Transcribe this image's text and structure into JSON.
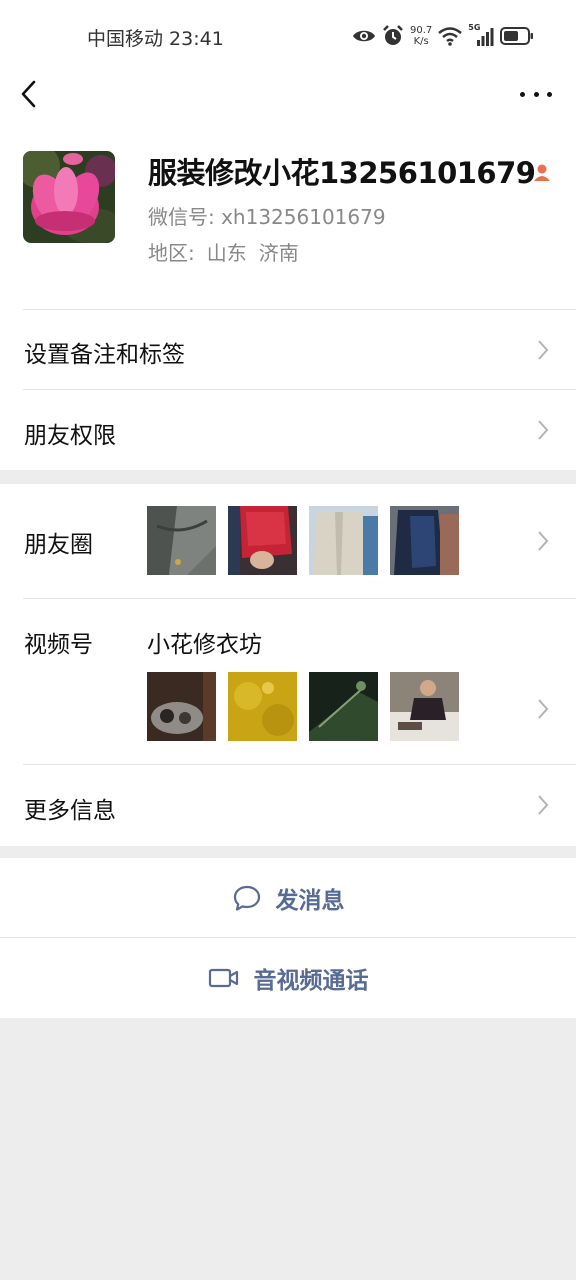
{
  "status_bar": {
    "carrier_time": "中国移动 23:41",
    "net_speed_value": "90.7",
    "net_speed_unit": "K/s",
    "network_type": "5G",
    "icons": [
      "eye-icon",
      "alarm-icon",
      "wifi-icon",
      "signal-icon",
      "battery-icon"
    ]
  },
  "nav": {
    "back_icon": "chevron-left-icon",
    "more_icon": "more-dots-icon"
  },
  "profile": {
    "name": "服装修改小花13256101679",
    "wechat_id": "微信号: xh13256101679",
    "region_label": "地区:",
    "region_province": "山东",
    "region_city": "济南"
  },
  "rows": {
    "remark_tags": "设置备注和标签",
    "permissions": "朋友权限",
    "moments": "朋友圈",
    "channels": "视频号",
    "channels_name": "小花修衣坊",
    "more_info": "更多信息"
  },
  "actions": {
    "message": "发消息",
    "av_call": "音视频通话"
  },
  "colors": {
    "link_blue": "#576b95",
    "page_bg": "#ededed",
    "divider": "#e6e6e6",
    "secondary_text": "#888888"
  }
}
